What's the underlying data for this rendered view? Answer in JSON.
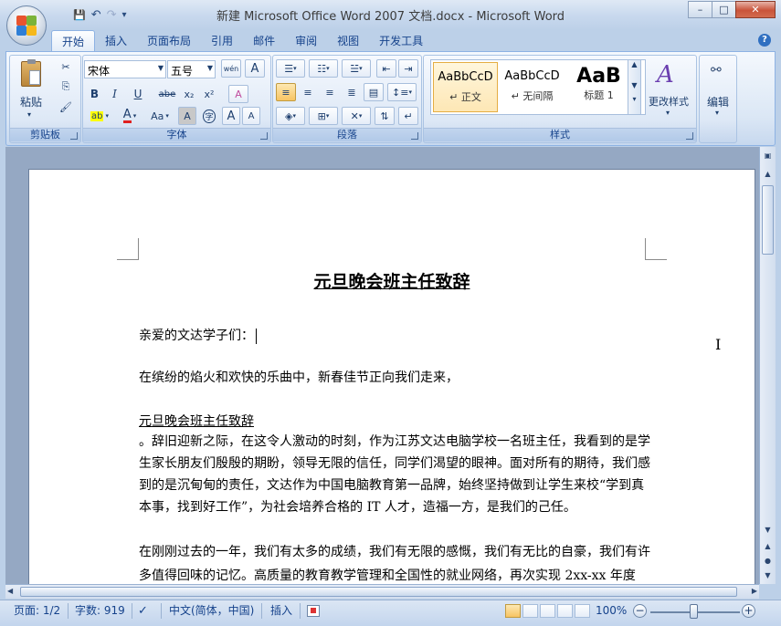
{
  "window": {
    "title": "新建 Microsoft Office Word 2007 文档.docx - Microsoft Word",
    "minimize": "–",
    "maximize": "□",
    "close": "✕"
  },
  "qat": {
    "save_icon": "💾",
    "undo_icon": "↶",
    "redo_icon": "↷",
    "customize_icon": "▾"
  },
  "tabs": [
    "开始",
    "插入",
    "页面布局",
    "引用",
    "邮件",
    "审阅",
    "视图",
    "开发工具"
  ],
  "help": "?",
  "ribbon": {
    "clipboard": {
      "label": "剪贴板",
      "paste": "粘贴",
      "cut_icon": "✂",
      "copy_icon": "⎘",
      "painter_icon": "🖌"
    },
    "font": {
      "label": "字体",
      "font_name": "宋体",
      "font_size": "五号",
      "wen": "wén",
      "A_box": "A",
      "bold": "B",
      "italic": "I",
      "underline": "U",
      "strike": "abe",
      "sub": "x₂",
      "sup": "x²",
      "clear": "A",
      "highlight": "ab",
      "font_color": "A",
      "case": "Aa",
      "shade": "A",
      "enclose": "字",
      "grow": "A",
      "shrink": "A"
    },
    "paragraph": {
      "label": "段落"
    },
    "styles": {
      "label": "样式",
      "items": [
        {
          "sample": "AaBbCcD",
          "name": "↵ 正文"
        },
        {
          "sample": "AaBbCcD",
          "name": "↵ 无间隔"
        },
        {
          "sample": "AaB",
          "name": "标题 1"
        }
      ],
      "change_styles": "更改样式"
    },
    "editing": {
      "label": "编辑",
      "icon": "🔭"
    }
  },
  "document": {
    "title": "元旦晚会班主任致辞",
    "greeting": "亲爱的文达学子们：",
    "line1": "在缤纷的焰火和欢快的乐曲中，新春佳节正向我们走来，",
    "subtitle": "元旦晚会班主任致辞",
    "para1": "。辞旧迎新之际，在这令人激动的时刻，作为江苏文达电脑学校一名班主任，我看到的是学生家长朋友们殷殷的期盼，领导无限的信任，同学们渴望的眼神。面对所有的期待，我们感到的是沉甸甸的责任，文达作为中国电脑教育第一品牌，始终坚持做到让学生来校“学到真本事，找到好工作”，为社会培养合格的 IT 人才，造福一方，是我们的己任。",
    "para2": "在刚刚过去的一年，我们有太多的成绩，我们有无限的感慨，我们有无比的自豪，我们有许多值得回味的记忆。高质量的教育教学管理和全国性的就业网络，再次实现 2xx-xx 年度"
  },
  "status": {
    "page": "页面: 1/2",
    "words": "字数: 919",
    "language": "中文(简体，中国)",
    "mode": "插入",
    "zoom": "100%",
    "zoom_level": 1.0
  }
}
